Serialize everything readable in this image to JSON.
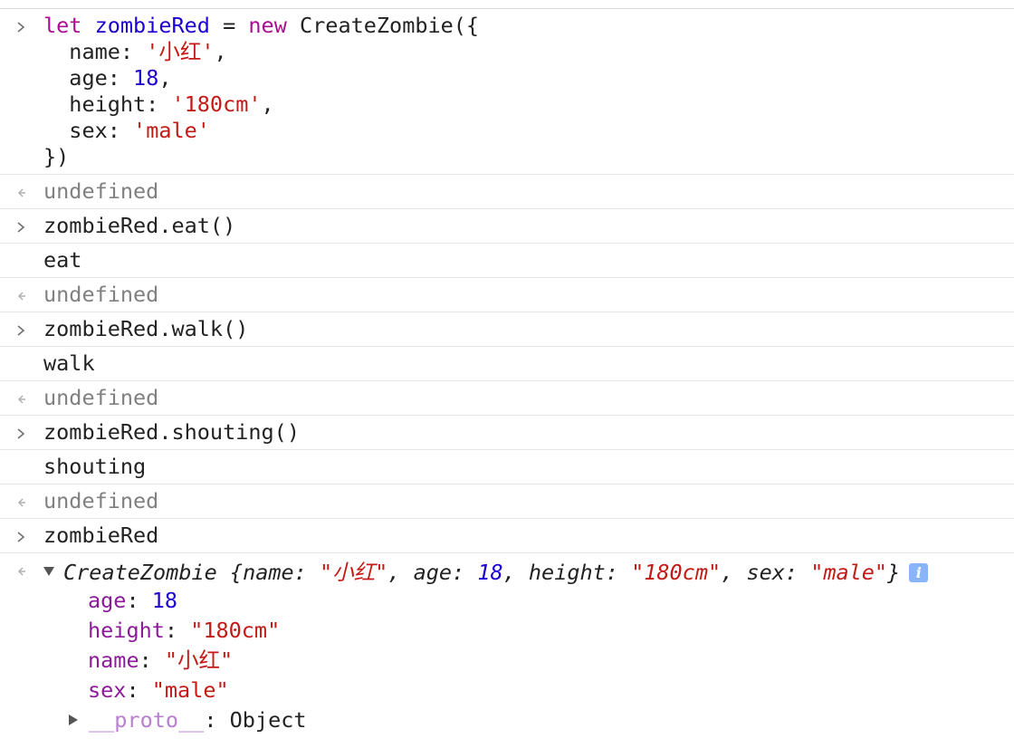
{
  "entries": [
    {
      "kind": "input",
      "lines": [
        {
          "t": [
            [
              "let",
              "kw"
            ],
            [
              " ",
              ""
            ],
            [
              "zombieRed",
              "var"
            ],
            [
              " = ",
              ""
            ],
            [
              "new",
              "kw"
            ],
            [
              " CreateZombie({",
              ""
            ]
          ]
        },
        {
          "t": [
            [
              "  name: ",
              ""
            ],
            [
              "'小红'",
              "str"
            ],
            [
              ",",
              ""
            ]
          ]
        },
        {
          "t": [
            [
              "  age: ",
              ""
            ],
            [
              "18",
              "num"
            ],
            [
              ",",
              ""
            ]
          ]
        },
        {
          "t": [
            [
              "  height: ",
              ""
            ],
            [
              "'180cm'",
              "str"
            ],
            [
              ",",
              ""
            ]
          ]
        },
        {
          "t": [
            [
              "  sex: ",
              ""
            ],
            [
              "'male'",
              "str"
            ]
          ]
        },
        {
          "t": [
            [
              "})",
              ""
            ]
          ]
        }
      ]
    },
    {
      "kind": "result",
      "text": "undefined"
    },
    {
      "kind": "input",
      "text": "zombieRed.eat()"
    },
    {
      "kind": "log",
      "text": "eat"
    },
    {
      "kind": "result",
      "text": "undefined"
    },
    {
      "kind": "input",
      "text": "zombieRed.walk()"
    },
    {
      "kind": "log",
      "text": "walk"
    },
    {
      "kind": "result",
      "text": "undefined"
    },
    {
      "kind": "input",
      "text": "zombieRed.shouting()"
    },
    {
      "kind": "log",
      "text": "shouting"
    },
    {
      "kind": "result",
      "text": "undefined"
    },
    {
      "kind": "input",
      "text": "zombieRed"
    }
  ],
  "object_result": {
    "preview": [
      [
        "CreateZombie {",
        ""
      ],
      [
        "name",
        ""
      ],
      [
        ": ",
        ""
      ],
      [
        "\"小红\"",
        "str"
      ],
      [
        ", ",
        ""
      ],
      [
        "age",
        ""
      ],
      [
        ": ",
        ""
      ],
      [
        "18",
        "num"
      ],
      [
        ", ",
        ""
      ],
      [
        "height",
        ""
      ],
      [
        ": ",
        ""
      ],
      [
        "\"180cm\"",
        "str"
      ],
      [
        ", ",
        ""
      ],
      [
        "sex",
        ""
      ],
      [
        ": ",
        ""
      ],
      [
        "\"male\"",
        "str"
      ],
      [
        "}",
        ""
      ]
    ],
    "info_icon": "i",
    "properties": [
      {
        "key": "age",
        "value": "18",
        "type": "num"
      },
      {
        "key": "height",
        "value": "\"180cm\"",
        "type": "str"
      },
      {
        "key": "name",
        "value": "\"小红\"",
        "type": "str"
      },
      {
        "key": "sex",
        "value": "\"male\"",
        "type": "str"
      }
    ],
    "proto": {
      "key": "__proto__",
      "value": "Object"
    }
  },
  "colors": {
    "keyword": "#aa0d91",
    "variable": "#1c00cf",
    "string": "#c41a16",
    "number": "#1c00cf",
    "property": "#8c1a99",
    "undefined": "#808080",
    "info_badge": "#8ab4f8"
  }
}
